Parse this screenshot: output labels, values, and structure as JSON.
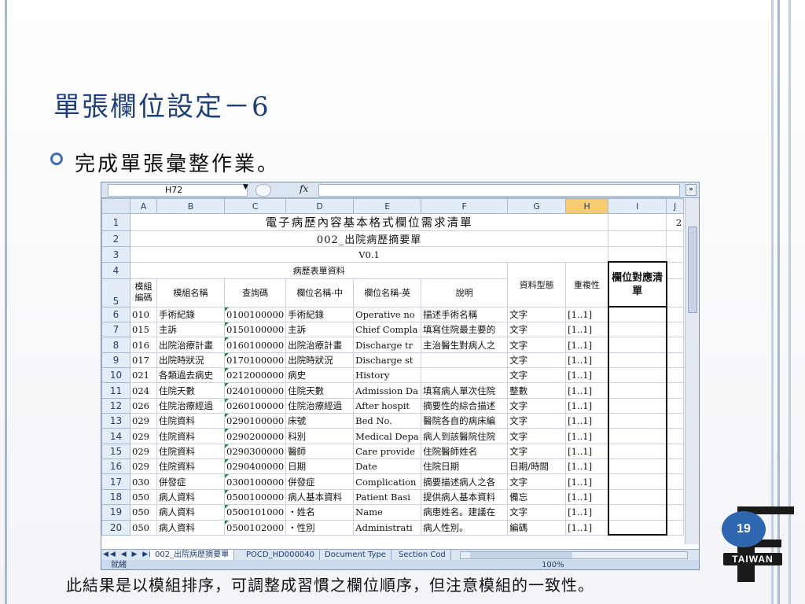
{
  "slide": {
    "title": "單張欄位設定－6",
    "bullet": "完成單張彙整作業。",
    "caption": "此結果是以模組排序，可調整成習慣之欄位順序，但注意模組的一致性。",
    "page_number": "19",
    "logo_text": "TAIWAN",
    "logo_letter": "E"
  },
  "excel": {
    "name_box": "H72",
    "fx_label": "fx",
    "columns": [
      "A",
      "B",
      "C",
      "D",
      "E",
      "F",
      "G",
      "H",
      "I",
      "J"
    ],
    "selected_column": "H",
    "title_row1": "電子病歷內容基本格式欄位需求清單",
    "row1_j": "2",
    "title_row2": "002_出院病歷摘要單",
    "title_row3": "V0.1",
    "section_header": "病歷表單資料",
    "col_headers": {
      "module_code": "模組編碼",
      "module_name": "模組名稱",
      "query_code": "查詢碼",
      "field_cn": "欄位名稱-中",
      "field_en": "欄位名稱-英",
      "desc": "說明",
      "data_type": "資料型態",
      "repeat": "重複性",
      "mapping": "欄位對應清單"
    },
    "rows": [
      {
        "r": "6",
        "a": "010",
        "b": "手術紀錄",
        "c": "0100100000",
        "d": "手術紀錄",
        "e": "Operative no",
        "f": "描述手術名稱",
        "g": "文字",
        "h": "[1..1]"
      },
      {
        "r": "7",
        "a": "015",
        "b": "主訴",
        "c": "0150100000",
        "d": "主訴",
        "e": "Chief Compla",
        "f": "填寫住院最主要的",
        "g": "文字",
        "h": "[1..1]"
      },
      {
        "r": "8",
        "a": "016",
        "b": "出院治療計畫",
        "c": "0160100000",
        "d": "出院治療計畫",
        "e": "Discharge tr",
        "f": "主治醫生對病人之",
        "g": "文字",
        "h": "[1..1]"
      },
      {
        "r": "9",
        "a": "017",
        "b": "出院時狀況",
        "c": "0170100000",
        "d": "出院時狀況",
        "e": "Discharge st",
        "f": "",
        "g": "文字",
        "h": "[1..1]"
      },
      {
        "r": "10",
        "a": "021",
        "b": "各類過去病史",
        "c": "0212000000",
        "d": "病史",
        "e": "History",
        "f": "",
        "g": "文字",
        "h": "[1..1]"
      },
      {
        "r": "11",
        "a": "024",
        "b": "住院天數",
        "c": "0240100000",
        "d": "住院天數",
        "e": "Admission Da",
        "f": "填寫病人單次住院",
        "g": "整數",
        "h": "[1..1]"
      },
      {
        "r": "12",
        "a": "026",
        "b": "住院治療經過",
        "c": "0260100000",
        "d": "住院治療經過",
        "e": "After hospit",
        "f": "摘要性的綜合描述",
        "g": "文字",
        "h": "[1..1]"
      },
      {
        "r": "13",
        "a": "029",
        "b": "住院資料",
        "c": "0290100000",
        "d": "床號",
        "e": "Bed No.",
        "f": "醫院各自的病床編",
        "g": "文字",
        "h": "[1..1]"
      },
      {
        "r": "14",
        "a": "029",
        "b": "住院資料",
        "c": "0290200000",
        "d": "科別",
        "e": "Medical Depa",
        "f": "病人到該醫院住院",
        "g": "文字",
        "h": "[1..1]"
      },
      {
        "r": "15",
        "a": "029",
        "b": "住院資料",
        "c": "0290300000",
        "d": "醫師",
        "e": "Care provide",
        "f": "住院醫師姓名",
        "g": "文字",
        "h": "[1..1]"
      },
      {
        "r": "16",
        "a": "029",
        "b": "住院資料",
        "c": "0290400000",
        "d": "日期",
        "e": "Date",
        "f": "住院日期",
        "g": "日期/時間",
        "h": "[1..1]"
      },
      {
        "r": "17",
        "a": "030",
        "b": "併發症",
        "c": "0300100000",
        "d": "併發症",
        "e": "Complication",
        "f": "摘要描述病人之各",
        "g": "文字",
        "h": "[1..1]"
      },
      {
        "r": "18",
        "a": "050",
        "b": "病人資料",
        "c": "0500100000",
        "d": "病人基本資料",
        "e": "Patient Basi",
        "f": "提供病人基本資料",
        "g": "備忘",
        "h": "[1..1]"
      },
      {
        "r": "19",
        "a": "050",
        "b": "病人資料",
        "c": "0500101000",
        "d": "・姓名",
        "e": "Name",
        "f": "病患姓名。建議在",
        "g": "文字",
        "h": "[1..1]"
      },
      {
        "r": "20",
        "a": "050",
        "b": "病人資料",
        "c": "0500102000",
        "d": "・性別",
        "e": "Administrati",
        "f": "病人性別。",
        "g": "編碼",
        "h": "[1..1]"
      }
    ],
    "sheet_tabs": [
      "002_出院病歷摘要單",
      "POCD_HD000040",
      "Document Type",
      "Section Cod"
    ],
    "status": "就緒",
    "zoom": "100%"
  }
}
